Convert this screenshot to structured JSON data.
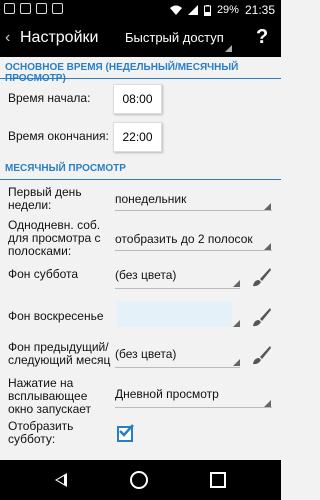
{
  "status_bar": {
    "battery": "29%",
    "time": "21:35"
  },
  "action_bar": {
    "back_glyph": "‹",
    "title": "Настройки",
    "quick_access": "Быстрый доступ",
    "help": "?"
  },
  "section_main": "ОСНОВНОЕ ВРЕМЯ (НЕДЕЛЬНЫЙ/МЕСЯЧНЫЙ ПРОСМОТР)",
  "start_time": {
    "label": "Время начала:",
    "value": "08:00"
  },
  "end_time": {
    "label": "Время окончания:",
    "value": "22:00"
  },
  "section_month": "МЕСЯЧНЫЙ ПРОСМОТР",
  "first_day": {
    "label_line1": "Первый день",
    "label_line2": "недели:",
    "value": "понедельник"
  },
  "one_day_events": {
    "label_line1": "Однодневн. соб.",
    "label_line2": "для просмотра с",
    "label_line3": "полосками:",
    "value": "отобразить до 2 полосок"
  },
  "saturday_bg": {
    "label": "Фон суббота",
    "value": "(без цвета)"
  },
  "sunday_bg": {
    "label": "Фон воскресенье",
    "value": ""
  },
  "prev_next_bg": {
    "label_line1": "Фон предыдущий/",
    "label_line2": "следующий месяц",
    "value": "(без цвета)"
  },
  "popup_click": {
    "label_line1": "Нажатие на",
    "label_line2": "всплывающее",
    "label_line3": "окно запускает",
    "value": "Дневной просмотр"
  },
  "show_saturday": {
    "label_line1": "Отобразить",
    "label_line2": "субботу:",
    "checked": true
  },
  "colors": {
    "accent": "#2a7fc4",
    "sunday_box": "#e4f1f8"
  }
}
